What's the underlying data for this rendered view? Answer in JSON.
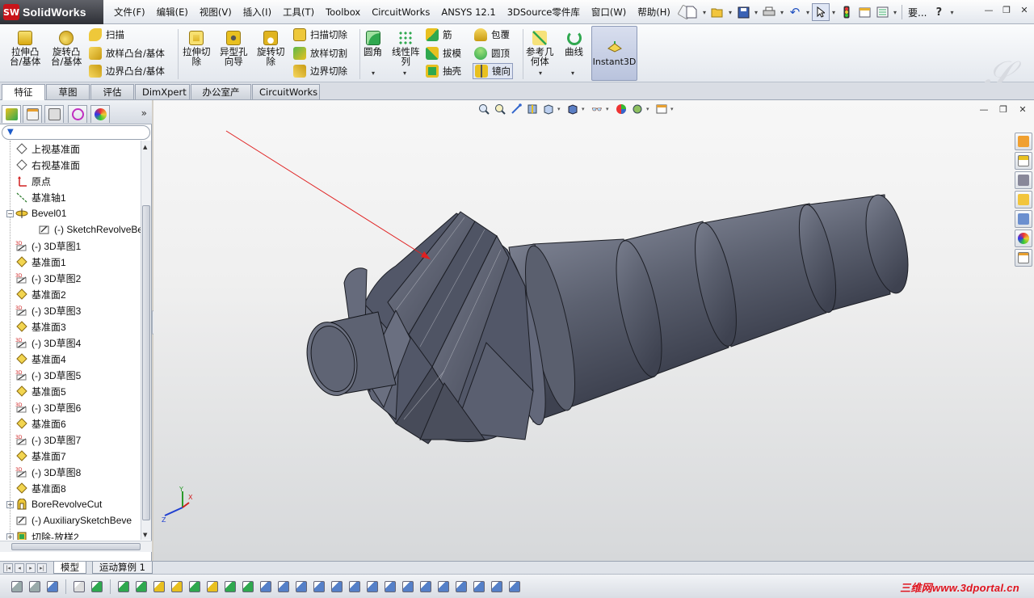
{
  "app": {
    "logo_mark": "SW",
    "name": "SolidWorks"
  },
  "menu": {
    "items": [
      "文件(F)",
      "编辑(E)",
      "视图(V)",
      "插入(I)",
      "工具(T)",
      "Toolbox",
      "CircuitWorks",
      "ANSYS 12.1",
      "3DSource零件库",
      "窗口(W)",
      "帮助(H)"
    ]
  },
  "quickbar": {
    "search_text": "要...",
    "help": "?"
  },
  "command_manager": {
    "features_left": [
      {
        "label": "拉伸凸\n台/基体",
        "color": "#e8c020"
      },
      {
        "label": "旋转凸\n台/基体",
        "color": "#e8c020"
      }
    ],
    "features_small_1": [
      {
        "label": "扫描",
        "color": "#e8c020"
      },
      {
        "label": "放样凸台/基体",
        "color": "#e8c020"
      },
      {
        "label": "边界凸台/基体",
        "color": "#e8c020"
      }
    ],
    "features_cut": [
      {
        "label": "拉伸切\n除",
        "color": "#e8c020"
      },
      {
        "label": "异型孔\n向导",
        "color": "#e8c020"
      },
      {
        "label": "旋转切\n除",
        "color": "#e8c020"
      }
    ],
    "features_small_2": [
      {
        "label": "扫描切除",
        "color": "#e8c020"
      },
      {
        "label": "放样切割",
        "color": "#e8c020"
      },
      {
        "label": "边界切除",
        "color": "#e8c020"
      }
    ],
    "fillet": {
      "label": "圆角",
      "color": "#2fa84f"
    },
    "pattern": {
      "label": "线性阵\n列",
      "color": "#2fa84f"
    },
    "features_small_3": [
      {
        "label": "筋",
        "color": "#2fa84f"
      },
      {
        "label": "拔模",
        "color": "#2fa84f"
      },
      {
        "label": "抽壳",
        "color": "#2fa84f"
      }
    ],
    "features_small_4": [
      {
        "label": "包覆",
        "color": "#e8c020"
      },
      {
        "label": "圆顶",
        "color": "#2fa84f"
      },
      {
        "label": "镜向",
        "color": "#e8c020"
      }
    ],
    "ref_geometry": {
      "label": "参考几\n何体",
      "color": "#2fa84f"
    },
    "curves": {
      "label": "曲线",
      "color": "#2fa84f"
    },
    "instant3d": {
      "label": "Instant3D"
    }
  },
  "cm_tabs": [
    "特征",
    "草图",
    "评估",
    "DimXpert",
    "办公室产品",
    "CircuitWorks"
  ],
  "feature_tree": {
    "items": [
      {
        "label": "上视基准面",
        "icon": "plane-icon",
        "indent": 0
      },
      {
        "label": "右视基准面",
        "icon": "plane-icon",
        "indent": 0
      },
      {
        "label": "原点",
        "icon": "origin-icon",
        "indent": 0
      },
      {
        "label": "基准轴1",
        "icon": "axis-icon",
        "indent": 0
      },
      {
        "label": "Bevel01",
        "icon": "revolve-icon",
        "indent": 0,
        "expand": "−"
      },
      {
        "label": "(-) SketchRevolveBe",
        "icon": "sketch-icon",
        "indent": 1
      },
      {
        "label": "(-) 3D草图1",
        "icon": "3dsketch-icon",
        "indent": 0
      },
      {
        "label": "基准面1",
        "icon": "refplane-icon",
        "indent": 0
      },
      {
        "label": "(-) 3D草图2",
        "icon": "3dsketch-icon",
        "indent": 0
      },
      {
        "label": "基准面2",
        "icon": "refplane-icon",
        "indent": 0
      },
      {
        "label": "(-) 3D草图3",
        "icon": "3dsketch-icon",
        "indent": 0
      },
      {
        "label": "基准面3",
        "icon": "refplane-icon",
        "indent": 0
      },
      {
        "label": "(-) 3D草图4",
        "icon": "3dsketch-icon",
        "indent": 0
      },
      {
        "label": "基准面4",
        "icon": "refplane-icon",
        "indent": 0
      },
      {
        "label": "(-) 3D草图5",
        "icon": "3dsketch-icon",
        "indent": 0
      },
      {
        "label": "基准面5",
        "icon": "refplane-icon",
        "indent": 0
      },
      {
        "label": "(-) 3D草图6",
        "icon": "3dsketch-icon",
        "indent": 0
      },
      {
        "label": "基准面6",
        "icon": "refplane-icon",
        "indent": 0
      },
      {
        "label": "(-) 3D草图7",
        "icon": "3dsketch-icon",
        "indent": 0
      },
      {
        "label": "基准面7",
        "icon": "refplane-icon",
        "indent": 0
      },
      {
        "label": "(-) 3D草图8",
        "icon": "3dsketch-icon",
        "indent": 0
      },
      {
        "label": "基准面8",
        "icon": "refplane-icon",
        "indent": 0
      },
      {
        "label": "BoreRevolveCut",
        "icon": "cut-icon",
        "indent": 0,
        "expand": "+"
      },
      {
        "label": "(-) AuxiliarySketchBeve",
        "icon": "sketch-icon",
        "indent": 0
      },
      {
        "label": "切除-放样2",
        "icon": "loftcut-icon",
        "indent": 0,
        "expand": "+"
      }
    ]
  },
  "bottom_tabs": [
    "模型",
    "运动算例 1"
  ],
  "triad": {
    "x": "X",
    "y": "Y",
    "z": "Z"
  },
  "watermark": "三维网www.3dportal.cn",
  "colors": {
    "accent": "#2f5db3",
    "model": "#5c6170",
    "arrow": "#e02020"
  }
}
